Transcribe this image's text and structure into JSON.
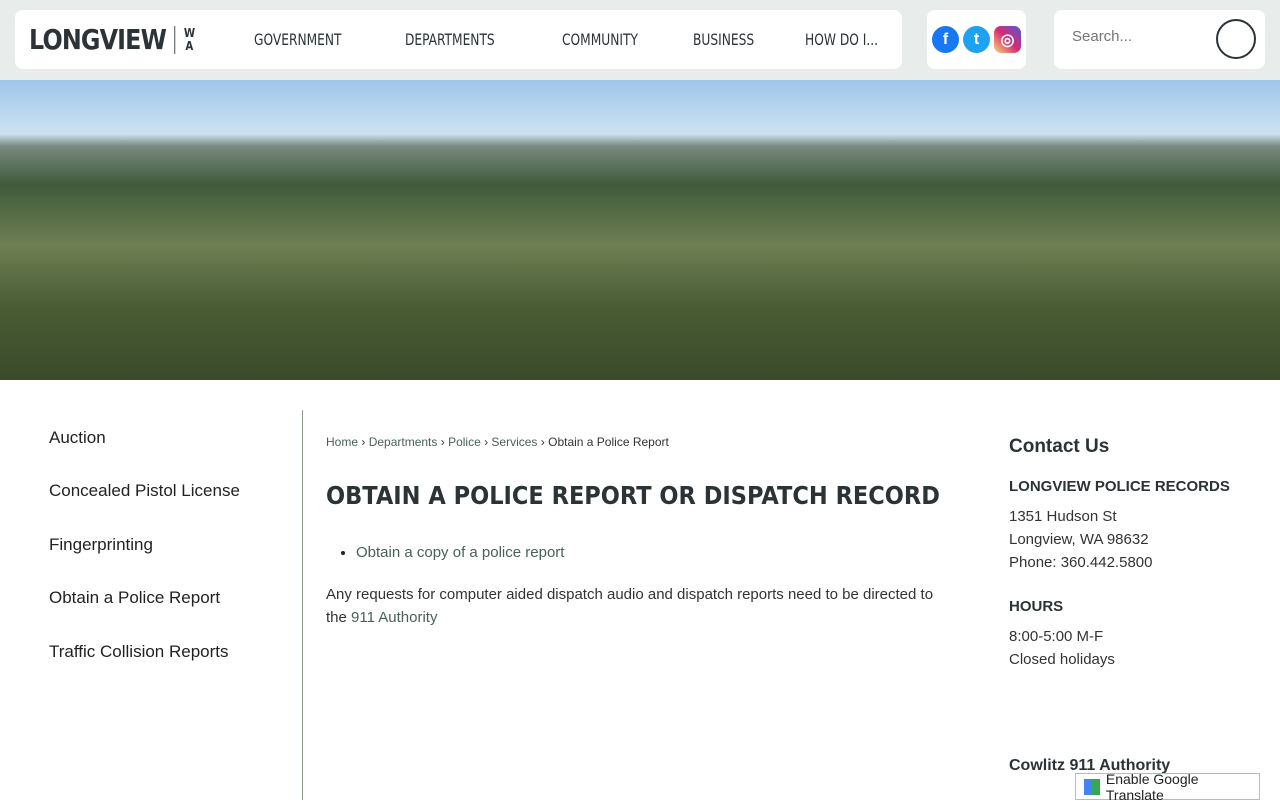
{
  "header": {
    "logo": "LONGVIEW",
    "logo_state_top": "W",
    "logo_state_bottom": "A",
    "nav": [
      "GOVERNMENT",
      "DEPARTMENTS",
      "COMMUNITY",
      "BUSINESS",
      "HOW DO I..."
    ],
    "social": [
      {
        "icon": "facebook-icon",
        "color": "#1877f2",
        "glyph": "f"
      },
      {
        "icon": "twitter-icon",
        "color": "#1da1f2",
        "glyph": "t"
      },
      {
        "icon": "instagram-icon",
        "color": "#d62976",
        "glyph": "◎"
      }
    ],
    "search_placeholder": "Search..."
  },
  "sidebar": [
    "Auction",
    "Concealed Pistol License",
    "Fingerprinting",
    "Obtain a Police Report",
    "Traffic Collision Reports"
  ],
  "breadcrumb": [
    "Home",
    "Departments",
    "Police",
    "Services",
    "Obtain a Police Report"
  ],
  "main": {
    "title": "OBTAIN A POLICE REPORT OR DISPATCH RECORD",
    "link": "Obtain a copy of a police report",
    "para": "Any requests for computer aided dispatch audio and dispatch reports need to be directed to the ",
    "para_link": "911 Authority"
  },
  "contact": {
    "title": "Contact Us",
    "org": "LONGVIEW POLICE RECORDS",
    "addr1": "1351 Hudson St",
    "addr2": "Longview, WA 98632",
    "phone": "Phone: 360.442.5800",
    "hours_title": "HOURS",
    "hours1": "8:00-5:00 M-F",
    "hours2": "Closed holidays",
    "cowlitz": "Cowlitz 911 Authority"
  },
  "translate": "Enable Google Translate"
}
